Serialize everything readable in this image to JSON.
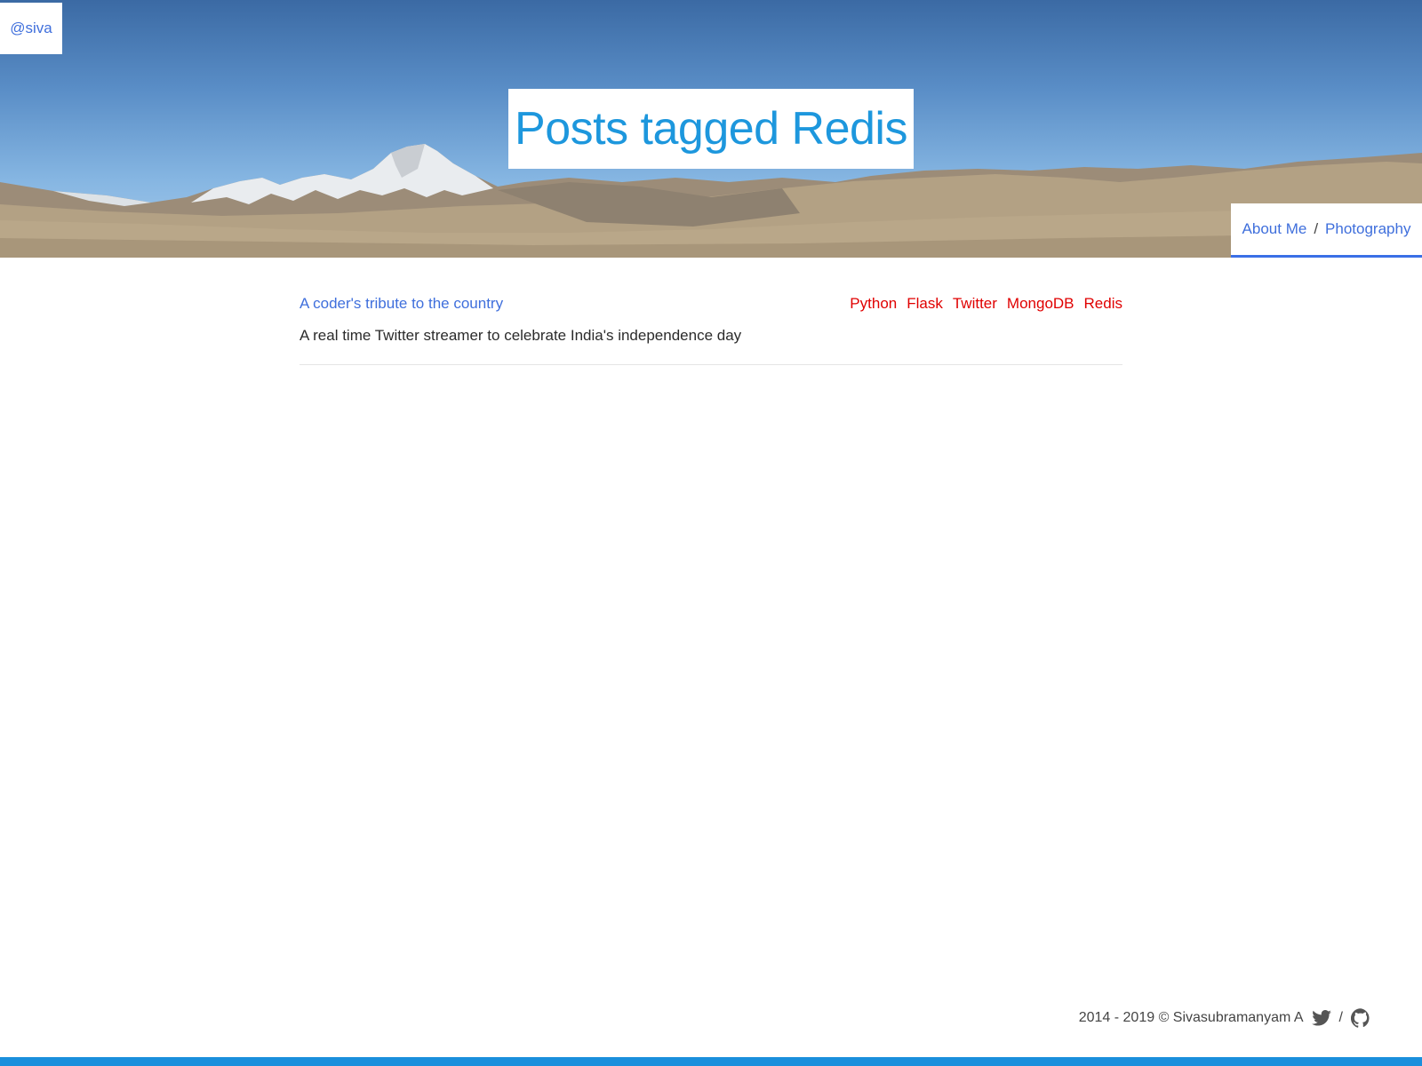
{
  "header": {
    "handle": "@siva",
    "title": "Posts tagged Redis",
    "nav": [
      {
        "label": "About Me"
      },
      {
        "label": "Photography"
      }
    ],
    "nav_separator": "/"
  },
  "posts": [
    {
      "title": "A coder's tribute to the country",
      "description": "A real time Twitter streamer to celebrate India's independence day",
      "tags": [
        "Python",
        "Flask",
        "Twitter",
        "MongoDB",
        "Redis"
      ]
    }
  ],
  "footer": {
    "copyright": "2014 - 2019 © Sivasubramanyam A",
    "separator": "/",
    "icons": [
      "twitter-icon",
      "github-icon"
    ]
  },
  "colors": {
    "link": "#3f6fdc",
    "title": "#1d97dd",
    "tag": "#e00000",
    "accent_bar": "#1a8fdc"
  }
}
